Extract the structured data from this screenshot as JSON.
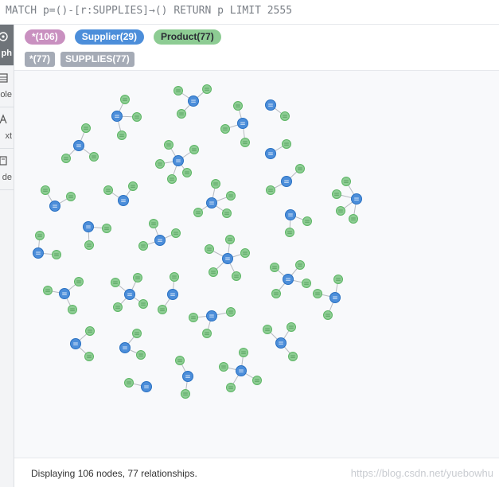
{
  "query": {
    "text": "MATCH p=()-[r:SUPPLIES]→() RETURN p LIMIT 2555"
  },
  "sidebar": {
    "items": [
      {
        "label": "ph",
        "icon": "graph-icon",
        "active": true
      },
      {
        "label": "ole",
        "icon": "table-icon",
        "active": false
      },
      {
        "label": "xt",
        "icon": "text-icon",
        "active": false
      },
      {
        "label": "de",
        "icon": "code-icon",
        "active": false
      }
    ]
  },
  "legend": {
    "node_labels": [
      {
        "label": "*(106)",
        "color": "#c990c0",
        "text_color": "#ffffff"
      },
      {
        "label": "Supplier(29)",
        "color": "#4c8eda",
        "text_color": "#ffffff"
      },
      {
        "label": "Product(77)",
        "color": "#8dcc93",
        "text_color": "#2a2c34"
      }
    ],
    "relationship_types": [
      {
        "label": "*(77)",
        "color": "#a5abb6",
        "text_color": "#ffffff"
      },
      {
        "label": "SUPPLIES(77)",
        "color": "#a5abb6",
        "text_color": "#ffffff"
      }
    ]
  },
  "graph": {
    "supplier_color": "#4c8eda",
    "supplier_stroke": "#2870c2",
    "product_color": "#8dcc93",
    "product_stroke": "#5db665",
    "edge_color": "#b6bac0",
    "clusters": [
      {
        "supplier": [
          243,
          127
        ],
        "products": [
          [
            224,
            114
          ],
          [
            260,
            112
          ],
          [
            228,
            143
          ]
        ]
      },
      {
        "supplier": [
          147,
          146
        ],
        "products": [
          [
            157,
            125
          ],
          [
            172,
            147
          ],
          [
            153,
            170
          ]
        ]
      },
      {
        "supplier": [
          99,
          183
        ],
        "products": [
          [
            108,
            161
          ],
          [
            83,
            199
          ],
          [
            118,
            197
          ]
        ]
      },
      {
        "supplier": [
          305,
          155
        ],
        "products": [
          [
            299,
            133
          ],
          [
            283,
            162
          ],
          [
            308,
            179
          ]
        ]
      },
      {
        "supplier": [
          340,
          132
        ],
        "products": [
          [
            358,
            146
          ]
        ]
      },
      {
        "supplier": [
          340,
          193
        ],
        "products": [
          [
            360,
            181
          ]
        ]
      },
      {
        "supplier": [
          224,
          202
        ],
        "products": [
          [
            212,
            182
          ],
          [
            244,
            188
          ],
          [
            201,
            206
          ],
          [
            235,
            217
          ],
          [
            216,
            225
          ]
        ]
      },
      {
        "supplier": [
          155,
          252
        ],
        "products": [
          [
            136,
            239
          ],
          [
            167,
            234
          ]
        ]
      },
      {
        "supplier": [
          69,
          259
        ],
        "products": [
          [
            57,
            239
          ],
          [
            89,
            247
          ]
        ]
      },
      {
        "supplier": [
          266,
          255
        ],
        "products": [
          [
            271,
            231
          ],
          [
            290,
            246
          ],
          [
            249,
            267
          ],
          [
            285,
            268
          ]
        ]
      },
      {
        "supplier": [
          360,
          228
        ],
        "products": [
          [
            377,
            212
          ],
          [
            340,
            239
          ]
        ]
      },
      {
        "supplier": [
          448,
          250
        ],
        "products": [
          [
            435,
            228
          ],
          [
            423,
            244
          ],
          [
            428,
            265
          ],
          [
            444,
            275
          ]
        ]
      },
      {
        "supplier": [
          365,
          270
        ],
        "products": [
          [
            386,
            278
          ],
          [
            364,
            292
          ]
        ]
      },
      {
        "supplier": [
          111,
          285
        ],
        "products": [
          [
            134,
            287
          ],
          [
            112,
            308
          ]
        ]
      },
      {
        "supplier": [
          201,
          302
        ],
        "products": [
          [
            193,
            281
          ],
          [
            221,
            293
          ],
          [
            180,
            309
          ]
        ]
      },
      {
        "supplier": [
          48,
          318
        ],
        "products": [
          [
            50,
            296
          ],
          [
            71,
            320
          ]
        ]
      },
      {
        "supplier": [
          286,
          325
        ],
        "products": [
          [
            289,
            301
          ],
          [
            308,
            318
          ],
          [
            263,
            313
          ],
          [
            268,
            342
          ],
          [
            297,
            347
          ]
        ]
      },
      {
        "supplier": [
          362,
          351
        ],
        "products": [
          [
            345,
            336
          ],
          [
            377,
            333
          ],
          [
            385,
            356
          ],
          [
            347,
            369
          ]
        ]
      },
      {
        "supplier": [
          81,
          369
        ],
        "products": [
          [
            99,
            354
          ],
          [
            60,
            365
          ],
          [
            91,
            389
          ]
        ]
      },
      {
        "supplier": [
          163,
          370
        ],
        "products": [
          [
            145,
            355
          ],
          [
            173,
            349
          ],
          [
            148,
            386
          ],
          [
            180,
            382
          ]
        ]
      },
      {
        "supplier": [
          217,
          370
        ],
        "products": [
          [
            219,
            348
          ],
          [
            204,
            389
          ]
        ]
      },
      {
        "supplier": [
          421,
          374
        ],
        "products": [
          [
            425,
            351
          ],
          [
            399,
            369
          ],
          [
            412,
            396
          ]
        ]
      },
      {
        "supplier": [
          266,
          397
        ],
        "products": [
          [
            243,
            399
          ],
          [
            290,
            392
          ],
          [
            260,
            419
          ]
        ]
      },
      {
        "supplier": [
          95,
          432
        ],
        "products": [
          [
            113,
            416
          ],
          [
            112,
            448
          ]
        ]
      },
      {
        "supplier": [
          157,
          437
        ],
        "products": [
          [
            172,
            419
          ],
          [
            177,
            446
          ]
        ]
      },
      {
        "supplier": [
          353,
          431
        ],
        "products": [
          [
            336,
            414
          ],
          [
            366,
            411
          ],
          [
            368,
            448
          ]
        ]
      },
      {
        "supplier": [
          236,
          473
        ],
        "products": [
          [
            226,
            453
          ],
          [
            233,
            495
          ]
        ]
      },
      {
        "supplier": [
          303,
          466
        ],
        "products": [
          [
            281,
            461
          ],
          [
            306,
            443
          ],
          [
            323,
            478
          ],
          [
            290,
            487
          ]
        ]
      },
      {
        "supplier": [
          184,
          486
        ],
        "products": [
          [
            162,
            481
          ]
        ]
      }
    ]
  },
  "status": {
    "text": "Displaying 106 nodes, 77 relationships."
  },
  "watermark": {
    "text": "https://blog.csdn.net/yuebowhu"
  }
}
